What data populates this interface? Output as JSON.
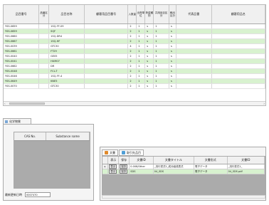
{
  "product_grid": {
    "columns": [
      "品目番号",
      "品番区分",
      "品目名称",
      "顧客用品目番号",
      "入数量",
      "出荷単位",
      "荷姿種別",
      "共用品目区分",
      "輸出区分",
      "代表品番",
      "顧客用品名"
    ],
    "rows": [
      {
        "code": "YSS-0659",
        "name": "1SQ-FF-09",
        "qty": "2",
        "unit": "1",
        "type": "s",
        "group": "1",
        "export": "s"
      },
      {
        "code": "YSS-0659",
        "name": "SQF",
        "qty": "2",
        "unit": "1",
        "type": "s",
        "group": "1",
        "export": "s"
      },
      {
        "code": "YSS-0660",
        "name": "1SQ-DR4",
        "qty": "2",
        "unit": "1",
        "type": "s",
        "group": "1",
        "export": "s"
      },
      {
        "code": "YSS-0667",
        "name": "1SQ-HF",
        "qty": "2",
        "unit": "1",
        "type": "s",
        "group": "1",
        "export": "s"
      },
      {
        "code": "YSS-0039",
        "name": "GTC30",
        "qty": "4",
        "unit": "1",
        "type": "s",
        "group": "1",
        "export": "s"
      },
      {
        "code": "YSS-0661",
        "name": "FT29",
        "qty": "2",
        "unit": "1",
        "type": "s",
        "group": "1",
        "export": "s"
      },
      {
        "code": "YSS-0040",
        "name": "GE05",
        "qty": "2",
        "unit": "1",
        "type": "s",
        "group": "1",
        "export": "s"
      },
      {
        "code": "YSS-0041",
        "name": "HUM07",
        "qty": "2",
        "unit": "1",
        "type": "s",
        "group": "1",
        "export": "s"
      },
      {
        "code": "YSS-0662",
        "name": "DR",
        "qty": "2",
        "unit": "1",
        "type": "s",
        "group": "1",
        "export": "s"
      },
      {
        "code": "YSS-0048",
        "name": "FCL-T",
        "qty": "2",
        "unit": "1",
        "type": "s",
        "group": "1",
        "export": "s"
      },
      {
        "code": "YSS-0046",
        "name": "1SQ-FF-4",
        "qty": "2",
        "unit": "1",
        "type": "s",
        "group": "1",
        "export": "s"
      },
      {
        "code": "YSS-0649",
        "name": "KNE5",
        "qty": "2",
        "unit": "1",
        "type": "s",
        "group": "1",
        "export": "s"
      },
      {
        "code": "YSS-0070",
        "name": "GTC30",
        "qty": "2",
        "unit": "1",
        "type": "s",
        "group": "1",
        "export": "s"
      }
    ],
    "green_rows": [
      1,
      3,
      5,
      7,
      9,
      11
    ],
    "scroll_left_arrow": "‹",
    "scroll_right_arrow": "›"
  },
  "substance_panel": {
    "tab_label": "化学物質",
    "columns": [
      "CAS No.",
      "Substance name"
    ],
    "footer_label": "最新更新日時",
    "footer_value": "0007470"
  },
  "document_panel": {
    "tabs": [
      "文書",
      "取引先品目"
    ],
    "columns": [
      "",
      "表示",
      "保存",
      "文書ID",
      "文書タイトル",
      "文書形式",
      "文書ID"
    ],
    "rows": [
      {
        "marker": "▸",
        "show": "表示",
        "save": "保存",
        "doc_id": "0.008/0ther",
        "title": "_流行書式1_成分組成表式",
        "format": "電子データ",
        "doc_id2": "_流行書式1_"
      },
      {
        "marker": "",
        "show": "表示",
        "save": "保存",
        "doc_id": "SDS",
        "title": "04_SDS",
        "format": "電子データ",
        "doc_id2": "04_SDS.pdf"
      }
    ]
  },
  "colors": {
    "row_green": "#d8f2cf",
    "header_gray": "#f0f0f0",
    "panel_gray": "#ababab"
  }
}
